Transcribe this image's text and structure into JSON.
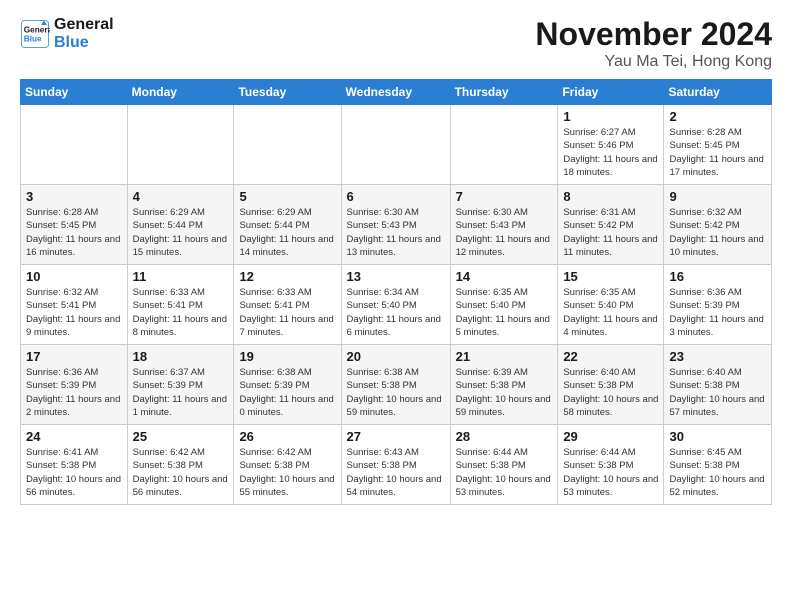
{
  "header": {
    "logo_line1": "General",
    "logo_line2": "Blue",
    "month": "November 2024",
    "location": "Yau Ma Tei, Hong Kong"
  },
  "weekdays": [
    "Sunday",
    "Monday",
    "Tuesday",
    "Wednesday",
    "Thursday",
    "Friday",
    "Saturday"
  ],
  "weeks": [
    [
      {
        "day": "",
        "info": ""
      },
      {
        "day": "",
        "info": ""
      },
      {
        "day": "",
        "info": ""
      },
      {
        "day": "",
        "info": ""
      },
      {
        "day": "",
        "info": ""
      },
      {
        "day": "1",
        "info": "Sunrise: 6:27 AM\nSunset: 5:46 PM\nDaylight: 11 hours and 18 minutes."
      },
      {
        "day": "2",
        "info": "Sunrise: 6:28 AM\nSunset: 5:45 PM\nDaylight: 11 hours and 17 minutes."
      }
    ],
    [
      {
        "day": "3",
        "info": "Sunrise: 6:28 AM\nSunset: 5:45 PM\nDaylight: 11 hours and 16 minutes."
      },
      {
        "day": "4",
        "info": "Sunrise: 6:29 AM\nSunset: 5:44 PM\nDaylight: 11 hours and 15 minutes."
      },
      {
        "day": "5",
        "info": "Sunrise: 6:29 AM\nSunset: 5:44 PM\nDaylight: 11 hours and 14 minutes."
      },
      {
        "day": "6",
        "info": "Sunrise: 6:30 AM\nSunset: 5:43 PM\nDaylight: 11 hours and 13 minutes."
      },
      {
        "day": "7",
        "info": "Sunrise: 6:30 AM\nSunset: 5:43 PM\nDaylight: 11 hours and 12 minutes."
      },
      {
        "day": "8",
        "info": "Sunrise: 6:31 AM\nSunset: 5:42 PM\nDaylight: 11 hours and 11 minutes."
      },
      {
        "day": "9",
        "info": "Sunrise: 6:32 AM\nSunset: 5:42 PM\nDaylight: 11 hours and 10 minutes."
      }
    ],
    [
      {
        "day": "10",
        "info": "Sunrise: 6:32 AM\nSunset: 5:41 PM\nDaylight: 11 hours and 9 minutes."
      },
      {
        "day": "11",
        "info": "Sunrise: 6:33 AM\nSunset: 5:41 PM\nDaylight: 11 hours and 8 minutes."
      },
      {
        "day": "12",
        "info": "Sunrise: 6:33 AM\nSunset: 5:41 PM\nDaylight: 11 hours and 7 minutes."
      },
      {
        "day": "13",
        "info": "Sunrise: 6:34 AM\nSunset: 5:40 PM\nDaylight: 11 hours and 6 minutes."
      },
      {
        "day": "14",
        "info": "Sunrise: 6:35 AM\nSunset: 5:40 PM\nDaylight: 11 hours and 5 minutes."
      },
      {
        "day": "15",
        "info": "Sunrise: 6:35 AM\nSunset: 5:40 PM\nDaylight: 11 hours and 4 minutes."
      },
      {
        "day": "16",
        "info": "Sunrise: 6:36 AM\nSunset: 5:39 PM\nDaylight: 11 hours and 3 minutes."
      }
    ],
    [
      {
        "day": "17",
        "info": "Sunrise: 6:36 AM\nSunset: 5:39 PM\nDaylight: 11 hours and 2 minutes."
      },
      {
        "day": "18",
        "info": "Sunrise: 6:37 AM\nSunset: 5:39 PM\nDaylight: 11 hours and 1 minute."
      },
      {
        "day": "19",
        "info": "Sunrise: 6:38 AM\nSunset: 5:39 PM\nDaylight: 11 hours and 0 minutes."
      },
      {
        "day": "20",
        "info": "Sunrise: 6:38 AM\nSunset: 5:38 PM\nDaylight: 10 hours and 59 minutes."
      },
      {
        "day": "21",
        "info": "Sunrise: 6:39 AM\nSunset: 5:38 PM\nDaylight: 10 hours and 59 minutes."
      },
      {
        "day": "22",
        "info": "Sunrise: 6:40 AM\nSunset: 5:38 PM\nDaylight: 10 hours and 58 minutes."
      },
      {
        "day": "23",
        "info": "Sunrise: 6:40 AM\nSunset: 5:38 PM\nDaylight: 10 hours and 57 minutes."
      }
    ],
    [
      {
        "day": "24",
        "info": "Sunrise: 6:41 AM\nSunset: 5:38 PM\nDaylight: 10 hours and 56 minutes."
      },
      {
        "day": "25",
        "info": "Sunrise: 6:42 AM\nSunset: 5:38 PM\nDaylight: 10 hours and 56 minutes."
      },
      {
        "day": "26",
        "info": "Sunrise: 6:42 AM\nSunset: 5:38 PM\nDaylight: 10 hours and 55 minutes."
      },
      {
        "day": "27",
        "info": "Sunrise: 6:43 AM\nSunset: 5:38 PM\nDaylight: 10 hours and 54 minutes."
      },
      {
        "day": "28",
        "info": "Sunrise: 6:44 AM\nSunset: 5:38 PM\nDaylight: 10 hours and 53 minutes."
      },
      {
        "day": "29",
        "info": "Sunrise: 6:44 AM\nSunset: 5:38 PM\nDaylight: 10 hours and 53 minutes."
      },
      {
        "day": "30",
        "info": "Sunrise: 6:45 AM\nSunset: 5:38 PM\nDaylight: 10 hours and 52 minutes."
      }
    ]
  ]
}
